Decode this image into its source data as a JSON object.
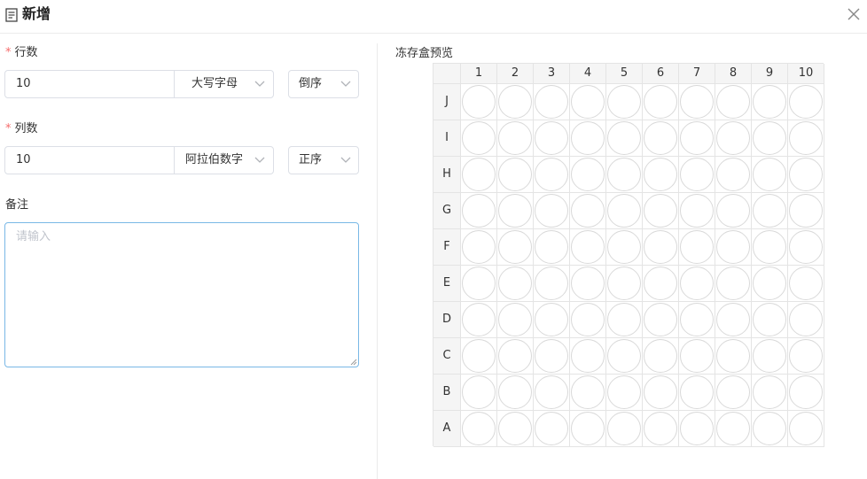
{
  "header": {
    "title": "新增",
    "icon": "form-icon",
    "close_icon": "close-icon"
  },
  "form": {
    "rows": {
      "label": "行数",
      "required_mark": "*",
      "value": "10",
      "label_type": "大写字母",
      "order": "倒序"
    },
    "cols": {
      "label": "列数",
      "required_mark": "*",
      "value": "10",
      "label_type": "阿拉伯数字",
      "order": "正序"
    },
    "remark": {
      "label": "备注",
      "placeholder": "请输入",
      "value": ""
    }
  },
  "preview": {
    "title": "冻存盒预览",
    "columns": [
      "1",
      "2",
      "3",
      "4",
      "5",
      "6",
      "7",
      "8",
      "9",
      "10"
    ],
    "rows": [
      "J",
      "I",
      "H",
      "G",
      "F",
      "E",
      "D",
      "C",
      "B",
      "A"
    ]
  },
  "colors": {
    "required": "#f56c6c",
    "border": "#dcdfe6",
    "focus_border": "#79b8e6",
    "placeholder": "#c0c4cc",
    "grid_line": "#e4e4e4",
    "header_bg": "#f5f5f5"
  }
}
